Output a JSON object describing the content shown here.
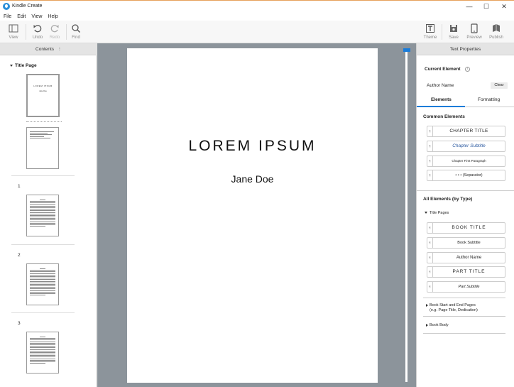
{
  "window": {
    "title": "Kindle Create",
    "minimize": "—",
    "maximize": "☐",
    "close": "✕"
  },
  "menu": [
    "File",
    "Edit",
    "View",
    "Help"
  ],
  "toolbar": {
    "view": "View",
    "undo": "Undo",
    "redo": "Redo",
    "find": "Find",
    "theme": "Theme",
    "save": "Save",
    "preview": "Preview",
    "publish": "Publish"
  },
  "contents": {
    "header": "Contents",
    "section": "Title Page",
    "thumb_title_text": "LOREM IPSUM",
    "thumb_author_text": "Jane Doe",
    "page_numbers": [
      "1",
      "2",
      "3"
    ]
  },
  "document": {
    "title": "LOREM IPSUM",
    "author": "Jane Doe"
  },
  "text_properties": {
    "header": "Text Properties",
    "current_element_label": "Current Element",
    "current_element_value": "Author Name",
    "clear": "Clear",
    "tabs": [
      "Elements",
      "Formatting"
    ],
    "common_heading": "Common Elements",
    "common": [
      "CHAPTER TITLE",
      "Chapter Subtitle",
      "Chapter First Paragraph",
      "• • •  (Separator)"
    ],
    "all_heading": "All Elements (by Type)",
    "title_pages_group": "Title Pages",
    "title_pages_items": [
      "BOOK TITLE",
      "Book Subtitle",
      "Author Name",
      "PART TITLE",
      "Part Subtitle"
    ],
    "book_start_line1": "Book Start and End Pages",
    "book_start_line2": "(e.g. Page Title, Dedication)",
    "book_body": "Book Body",
    "tag_glyph": "¶"
  },
  "colors": {
    "accent": "#1a7cd9",
    "canvas": "#8c949b",
    "panel_header": "#e4e4e4"
  }
}
